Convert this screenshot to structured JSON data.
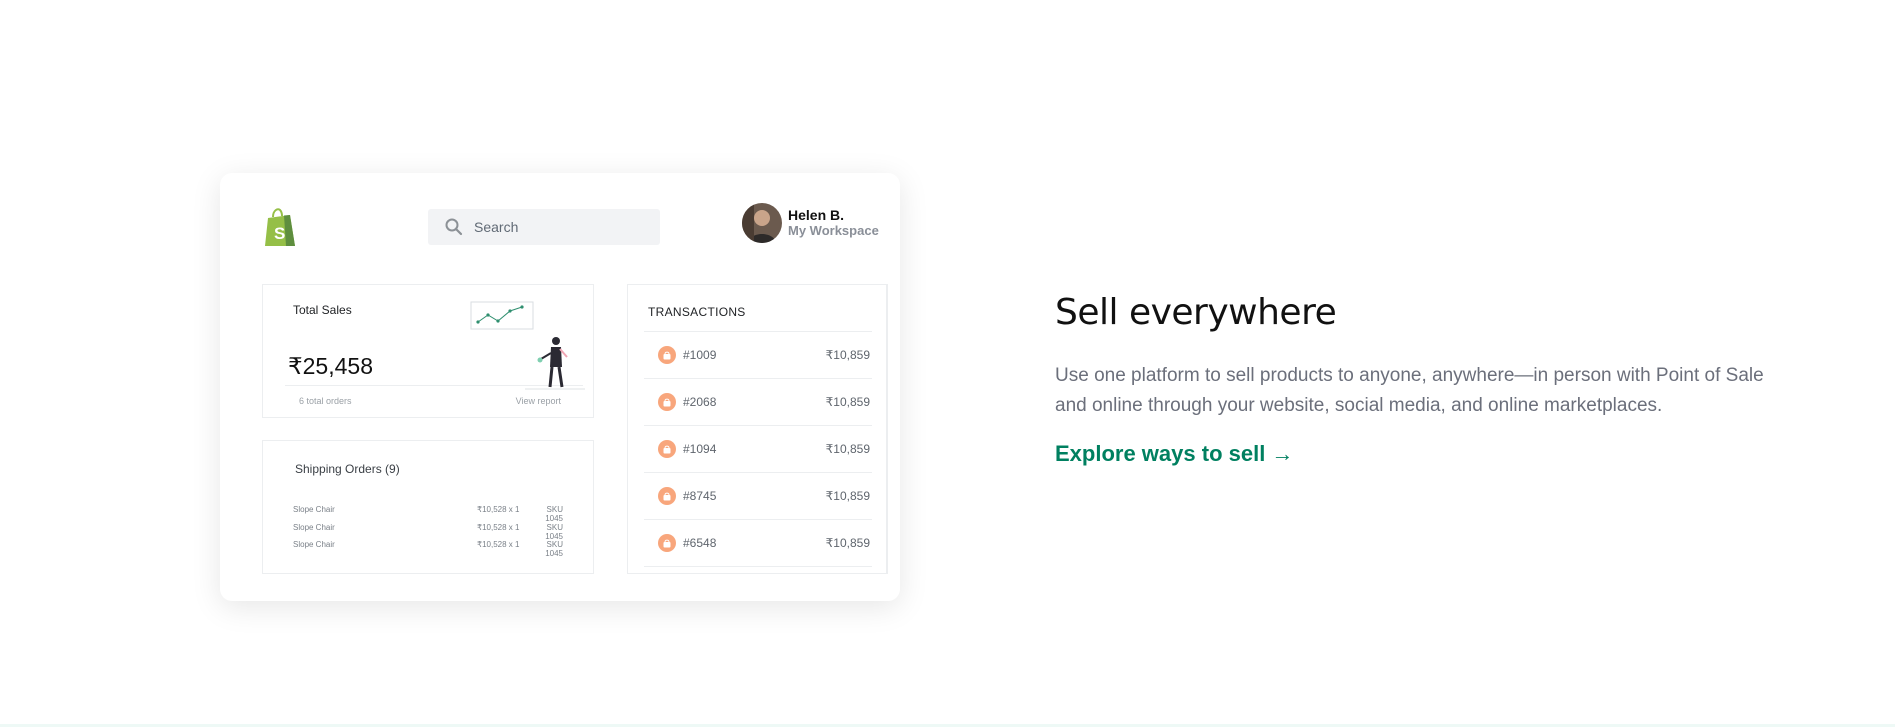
{
  "header": {
    "search_placeholder": "Search"
  },
  "user": {
    "name": "Helen B.",
    "workspace": "My Workspace"
  },
  "sales": {
    "title": "Total Sales",
    "currency": "₹",
    "value": "25,458",
    "orders": "6 total orders",
    "report": "View report"
  },
  "shipping": {
    "title": "Shipping Orders (9)",
    "rows": [
      {
        "name": "Slope Chair",
        "price": "₹10,528 x 1",
        "sku": "SKU 1045"
      },
      {
        "name": "Slope Chair",
        "price": "₹10,528 x 1",
        "sku": "SKU 1045"
      },
      {
        "name": "Slope Chair",
        "price": "₹10,528 x 1",
        "sku": "SKU 1045"
      }
    ]
  },
  "transactions": {
    "title": "TRANSACTIONS",
    "items": [
      {
        "id": "#1009",
        "amount": "₹10,859"
      },
      {
        "id": "#2068",
        "amount": "₹10,859"
      },
      {
        "id": "#1094",
        "amount": "₹10,859"
      },
      {
        "id": "#8745",
        "amount": "₹10,859"
      },
      {
        "id": "#6548",
        "amount": "₹10,859"
      }
    ]
  },
  "copy": {
    "heading": "Sell everywhere",
    "body": "Use one platform to sell products to anyone, anywhere—in person with Point of Sale and online through your website, social media, and online marketplaces.",
    "cta": "Explore ways to sell →"
  },
  "colors": {
    "brand": "#008060",
    "logo_green": "#95bf47",
    "tx_dot": "#f8a67c"
  },
  "icons": [
    "shopify-logo-icon",
    "search-icon",
    "avatar",
    "sales-illustration",
    "bag-icon"
  ]
}
